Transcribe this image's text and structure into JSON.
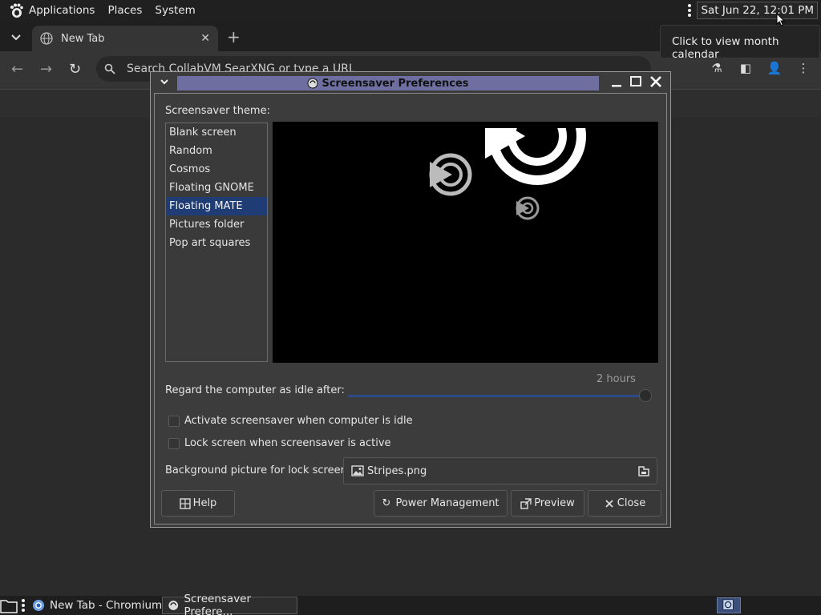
{
  "top_panel": {
    "menus": [
      "Applications",
      "Places",
      "System"
    ],
    "clock": "Sat Jun 22, 12:01 PM",
    "tooltip": "Click to view month calendar"
  },
  "browser": {
    "tab_title": "New Tab",
    "omnibox_placeholder": "Search CollabVM SearXNG or type a URL"
  },
  "dialog": {
    "title": "Screensaver Preferences",
    "theme_label": "Screensaver theme:",
    "themes": [
      "Blank screen",
      "Random",
      "Cosmos",
      "Floating GNOME",
      "Floating MATE",
      "Pictures folder",
      "Pop art squares"
    ],
    "selected_theme": "Floating MATE",
    "idle_label": "Regard the computer as idle after:",
    "idle_value": "2 hours",
    "idle_fraction": 1.0,
    "activate_label": "Activate screensaver when computer is idle",
    "activate_checked": false,
    "lock_label": "Lock screen when screensaver is active",
    "lock_checked": false,
    "bg_label": "Background picture for lock screen:",
    "bg_file": "Stripes.png",
    "buttons": {
      "help": "Help",
      "power": "Power Management",
      "preview": "Preview",
      "close": "Close"
    }
  },
  "taskbar": {
    "items": [
      "New Tab - Chromium",
      "Screensaver Prefere..."
    ]
  }
}
